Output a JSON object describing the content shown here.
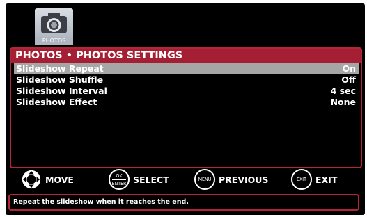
{
  "app": {
    "source_tile": {
      "label": "PHOTOS",
      "icon": "camera-icon"
    }
  },
  "panel": {
    "title": "PHOTOS • PHOTOS SETTINGS",
    "accent_color": "#a41f33",
    "rows": [
      {
        "label": "Slideshow Repeat",
        "value": "On",
        "selected": true
      },
      {
        "label": "Slideshow Shuffle",
        "value": "Off",
        "selected": false
      },
      {
        "label": "Slideshow Interval",
        "value": "4 sec",
        "selected": false
      },
      {
        "label": "Slideshow Effect",
        "value": "None",
        "selected": false
      }
    ]
  },
  "controls": {
    "move": {
      "label": "MOVE",
      "icon": "dpad-icon"
    },
    "select": {
      "label": "SELECT",
      "button_line1": "OK",
      "button_line2": "ENTER"
    },
    "previous": {
      "label": "PREVIOUS",
      "button": "MENU"
    },
    "exit": {
      "label": "EXIT",
      "button": "EXIT"
    }
  },
  "help_text": "Repeat the slideshow when it reaches the end."
}
